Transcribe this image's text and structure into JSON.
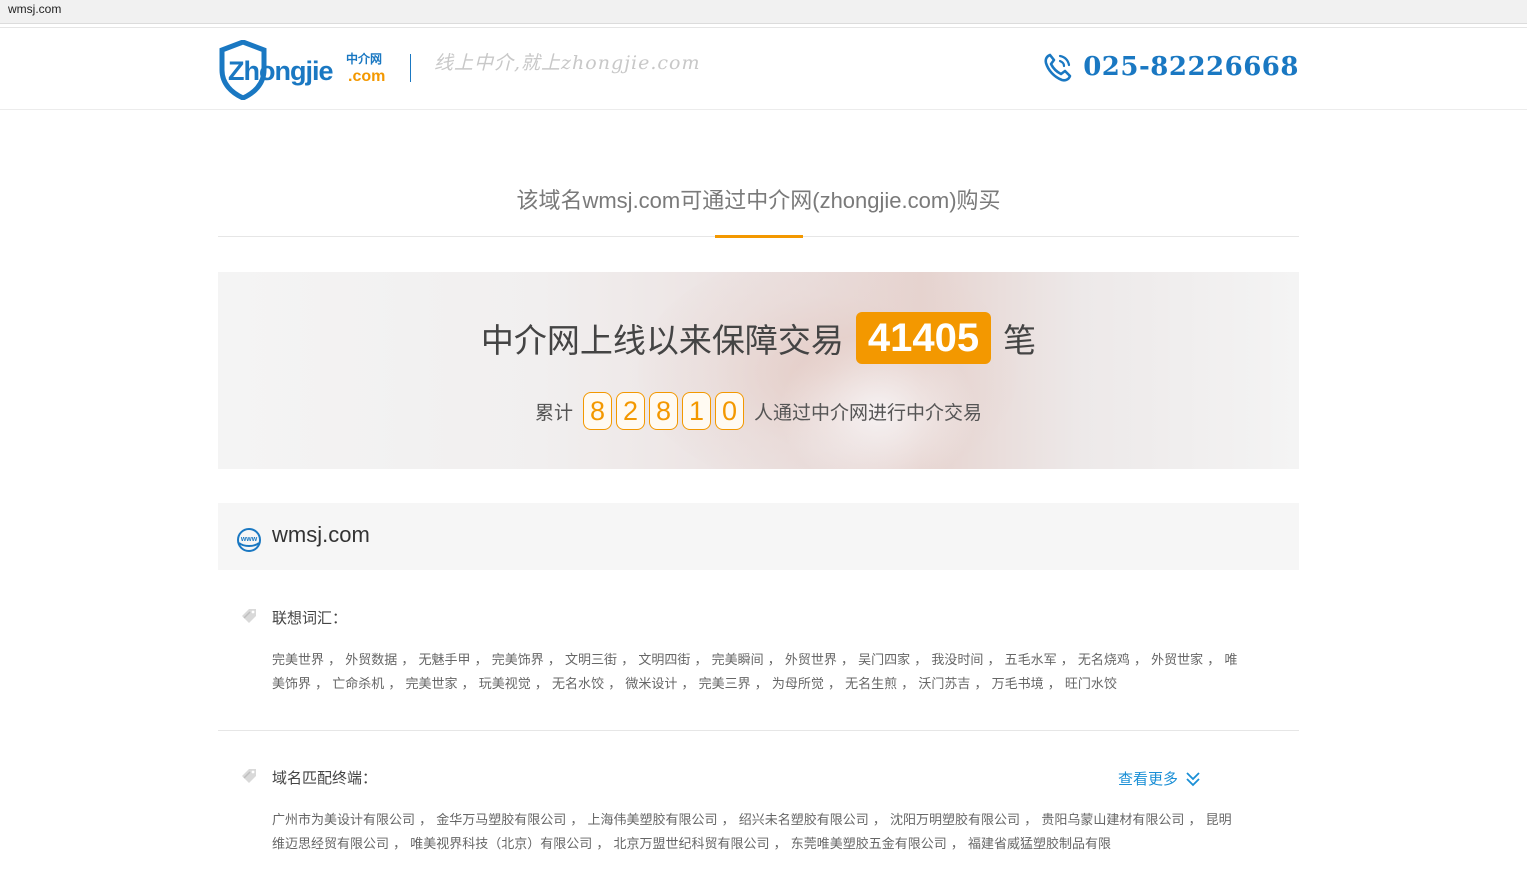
{
  "browser": {
    "url": "wmsj.com"
  },
  "header": {
    "logo_text": "Zhongjie",
    "logo_cn": "中介网",
    "logo_com": ".com",
    "slogan": "线上中介,就上zhongjie.com",
    "phone": "025-82226668"
  },
  "title": "该域名wmsj.com可通过中介网(zhongjie.com)购买",
  "banner": {
    "line1_prefix": "中介网上线以来保障交易",
    "trade_count": "41405",
    "line1_suffix": "笔",
    "line2_prefix": "累计",
    "digits": [
      "8",
      "2",
      "8",
      "1",
      "0"
    ],
    "line2_suffix": "人通过中介网进行中介交易"
  },
  "domain": {
    "name": "wmsj.com"
  },
  "associations": {
    "label": "联想词汇：",
    "text": "完美世界 ， 外贸数据 ， 无魅手甲 ， 完美饰界 ， 文明三街 ， 文明四街 ， 完美瞬间 ， 外贸世界 ， 吴门四家 ， 我没时间 ， 五毛水军 ， 无名烧鸡 ， 外贸世家 ， 唯美饰界 ， 亡命杀机 ， 完美世家 ， 玩美视觉 ， 无名水饺 ， 微米设计 ， 完美三界 ， 为母所觉 ， 无名生煎 ， 沃门苏吉 ， 万毛书境 ， 旺门水饺"
  },
  "matches": {
    "label": "域名匹配终端：",
    "more_label": "查看更多",
    "text": "广州市为美设计有限公司 ， 金华万马塑胶有限公司 ， 上海伟美塑胶有限公司 ， 绍兴未名塑胶有限公司 ， 沈阳万明塑胶有限公司 ， 贵阳乌蒙山建材有限公司 ， 昆明维迈思经贸有限公司 ， 唯美视界科技（北京）有限公司 ， 北京万盟世纪科贸有限公司 ， 东莞唯美塑胶五金有限公司 ， 福建省威猛塑胶制品有限"
  }
}
